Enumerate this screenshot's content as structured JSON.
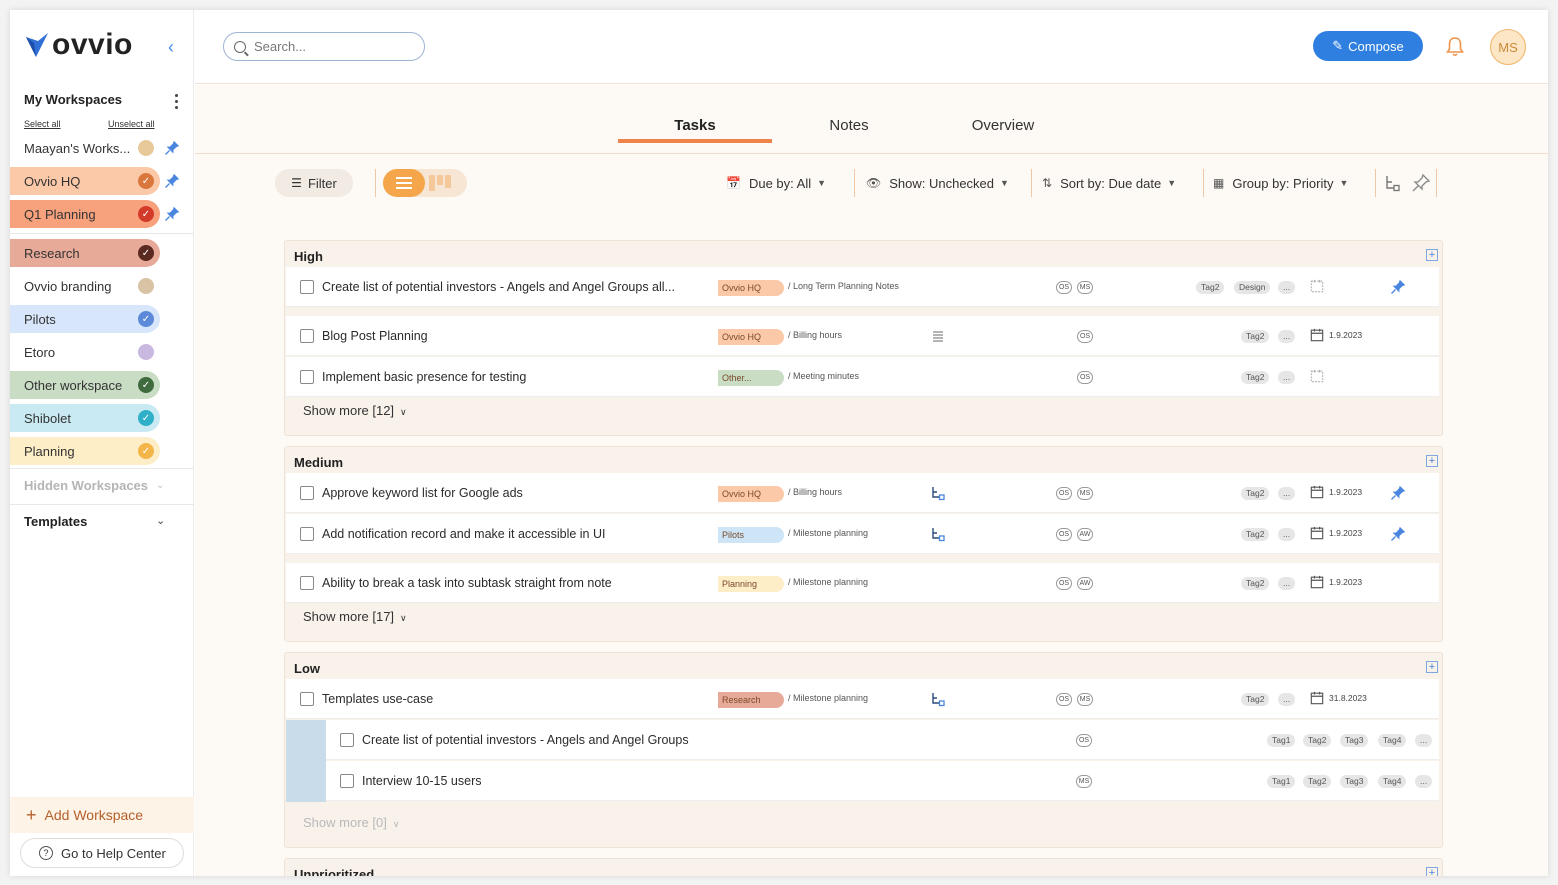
{
  "brand": {
    "name": "ovvio",
    "accent": "#f0834a",
    "blue": "#2f7fe0"
  },
  "sidebar": {
    "title": "My Workspaces",
    "select_all": "Select all",
    "unselect_all": "Unselect all",
    "workspaces": [
      {
        "label": "Maayan's Works...",
        "bg": "#ffffff",
        "dot": "#e8c99a",
        "checked": false,
        "pinned": true
      },
      {
        "label": "Ovvio HQ",
        "bg": "#fbc9a8",
        "dot": "#d9773c",
        "checked": true,
        "pinned": true
      },
      {
        "label": "Q1 Planning",
        "bg": "#f7a27d",
        "dot": "#d23a2a",
        "checked": true,
        "pinned": true
      },
      {
        "label": "Research",
        "bg": "#e8aa98",
        "dot": "#5a2a20",
        "checked": true,
        "pinned": false
      },
      {
        "label": "Ovvio branding",
        "bg": "#ffffff",
        "dot": "#d8c3a4",
        "checked": false,
        "pinned": false
      },
      {
        "label": "Pilots",
        "bg": "#d8e6fb",
        "dot": "#5c8ad8",
        "checked": true,
        "pinned": false
      },
      {
        "label": "Etoro",
        "bg": "#ffffff",
        "dot": "#c9b8e0",
        "checked": false,
        "pinned": false
      },
      {
        "label": "Other workspace",
        "bg": "#c9dcc4",
        "dot": "#3f6b3e",
        "checked": true,
        "pinned": false
      },
      {
        "label": "Shibolet",
        "bg": "#c9eaf3",
        "dot": "#2fb0c8",
        "checked": true,
        "pinned": false
      },
      {
        "label": "Planning",
        "bg": "#fdeec7",
        "dot": "#f4b54a",
        "checked": true,
        "pinned": false
      }
    ],
    "hidden_workspaces": "Hidden Workspaces",
    "templates": "Templates",
    "add_workspace": "Add Workspace",
    "help": "Go to Help Center"
  },
  "topbar": {
    "search_placeholder": "Search...",
    "compose": "Compose",
    "avatar": "MS"
  },
  "tabs": [
    "Tasks",
    "Notes",
    "Overview"
  ],
  "toolbar": {
    "filter": "Filter",
    "due_by": "Due by: All",
    "show": "Show: Unchecked",
    "sort": "Sort by: Due date",
    "group": "Group by: Priority"
  },
  "groups": [
    {
      "title": "High",
      "show_more": "Show more [12]",
      "tasks": [
        {
          "title": "Create list of potential investors - Angels and Angel Groups all...",
          "ws": "Ovvio HQ",
          "ws_bg": "#fbc9a8",
          "note": "/ Long Term Planning Notes",
          "icon": "",
          "assignees": [
            "OS",
            "MS"
          ],
          "tags": [
            "Tag2",
            "Design",
            "..."
          ],
          "date": "",
          "cal": true,
          "pin": true
        },
        {
          "title": "Blog Post Planning",
          "ws": "Ovvio HQ",
          "ws_bg": "#fbc9a8",
          "note": "/ Billing hours",
          "icon": "lines",
          "assignees": [
            "OS"
          ],
          "tags": [
            "Tag2",
            "..."
          ],
          "date": "1.9.2023",
          "cal": true,
          "pin": false
        },
        {
          "title": "Implement basic presence for testing",
          "ws": "Other...",
          "ws_bg": "#c9dcc4",
          "note": "/ Meeting minutes",
          "icon": "",
          "assignees": [
            "OS"
          ],
          "tags": [
            "Tag2",
            "..."
          ],
          "date": "",
          "cal": true,
          "pin": false
        }
      ]
    },
    {
      "title": "Medium",
      "show_more": "Show more [17]",
      "tasks": [
        {
          "title": "Approve keyword list for Google ads",
          "ws": "Ovvio HQ",
          "ws_bg": "#fbc9a8",
          "note": "/ Billing hours",
          "icon": "sub",
          "assignees": [
            "OS",
            "MS"
          ],
          "tags": [
            "Tag2",
            "..."
          ],
          "date": "1.9.2023",
          "cal": true,
          "pin": true
        },
        {
          "title": "Add notification record and make it accessible in UI",
          "ws": "Pilots",
          "ws_bg": "#cde5f7",
          "note": "/ Milestone planning",
          "icon": "sub",
          "assignees": [
            "OS",
            "AW"
          ],
          "tags": [
            "Tag2",
            "..."
          ],
          "date": "1.9.2023",
          "cal": true,
          "pin": true
        },
        {
          "title": "Ability to break a task into subtask straight from note",
          "ws": "Planning",
          "ws_bg": "#fdeec7",
          "note": "/ Milestone planning",
          "icon": "",
          "assignees": [
            "OS",
            "AW"
          ],
          "tags": [
            "Tag2",
            "..."
          ],
          "date": "1.9.2023",
          "cal": true,
          "pin": false
        }
      ]
    },
    {
      "title": "Low",
      "show_more": "Show more [0]",
      "tasks": [
        {
          "title": "Templates use-case",
          "ws": "Research",
          "ws_bg": "#e8aa98",
          "note": "/ Milestone planning",
          "icon": "sub",
          "assignees": [
            "OS",
            "MS"
          ],
          "tags": [
            "Tag2",
            "..."
          ],
          "date": "31.8.2023",
          "cal": true,
          "pin": false
        }
      ],
      "subtasks": [
        {
          "title": "Create list of potential investors - Angels and Angel Groups",
          "assignees": [
            "OS"
          ],
          "tags": [
            "Tag1",
            "Tag2",
            "Tag3",
            "Tag4",
            "..."
          ]
        },
        {
          "title": "Interview 10-15 users",
          "assignees": [
            "MS"
          ],
          "tags": [
            "Tag1",
            "Tag2",
            "Tag3",
            "Tag4",
            "..."
          ]
        }
      ]
    },
    {
      "title": "Unprioritized"
    }
  ]
}
